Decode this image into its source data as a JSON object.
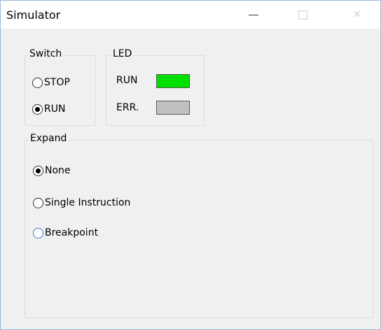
{
  "window": {
    "title": "Simulator",
    "controls": {
      "minimize": "minimize-icon",
      "maximize": "maximize-icon",
      "close": "close-icon"
    }
  },
  "switch": {
    "legend": "Switch",
    "options": [
      {
        "label": "STOP",
        "selected": false
      },
      {
        "label": "RUN",
        "selected": true
      }
    ]
  },
  "led": {
    "legend": "LED",
    "items": [
      {
        "label": "RUN",
        "color": "#00e000"
      },
      {
        "label": "ERR.",
        "color": "#c0c0c0"
      }
    ]
  },
  "expand": {
    "legend": "Expand",
    "options": [
      {
        "label": "None",
        "selected": true
      },
      {
        "label": "Single Instruction",
        "selected": false
      },
      {
        "label": "Breakpoint",
        "selected": false
      }
    ]
  }
}
